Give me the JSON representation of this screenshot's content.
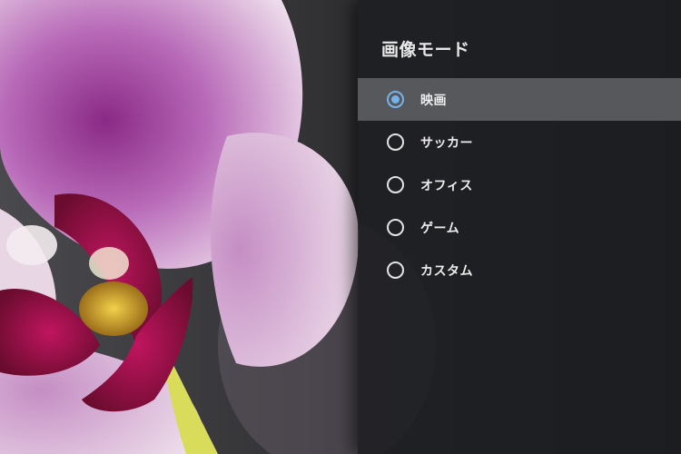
{
  "settings_panel": {
    "title": "画像モード",
    "selected_index": 0,
    "options": [
      {
        "label": "映画",
        "checked": true
      },
      {
        "label": "サッカー",
        "checked": false
      },
      {
        "label": "オフィス",
        "checked": false
      },
      {
        "label": "ゲーム",
        "checked": false
      },
      {
        "label": "カスタム",
        "checked": false
      }
    ]
  },
  "colors": {
    "accent": "#74b3ee",
    "selected_row": "#56585c",
    "panel_bg": "#1e1f22",
    "text": "#ededed"
  },
  "background": {
    "subject": "orchid-photo"
  }
}
